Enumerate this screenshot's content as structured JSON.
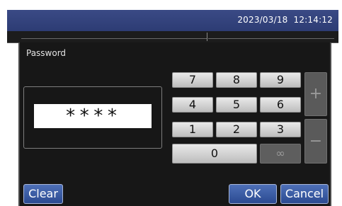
{
  "header": {
    "date": "2023/03/18",
    "time": "12:14:12"
  },
  "dialog": {
    "title": "Password",
    "password_mask": "****"
  },
  "keypad": {
    "digits": [
      "7",
      "8",
      "9",
      "4",
      "5",
      "6",
      "1",
      "2",
      "3"
    ],
    "zero": "0",
    "infinity": "∞",
    "plus": "+",
    "minus": "−"
  },
  "buttons": {
    "clear": "Clear",
    "ok": "OK",
    "cancel": "Cancel"
  }
}
